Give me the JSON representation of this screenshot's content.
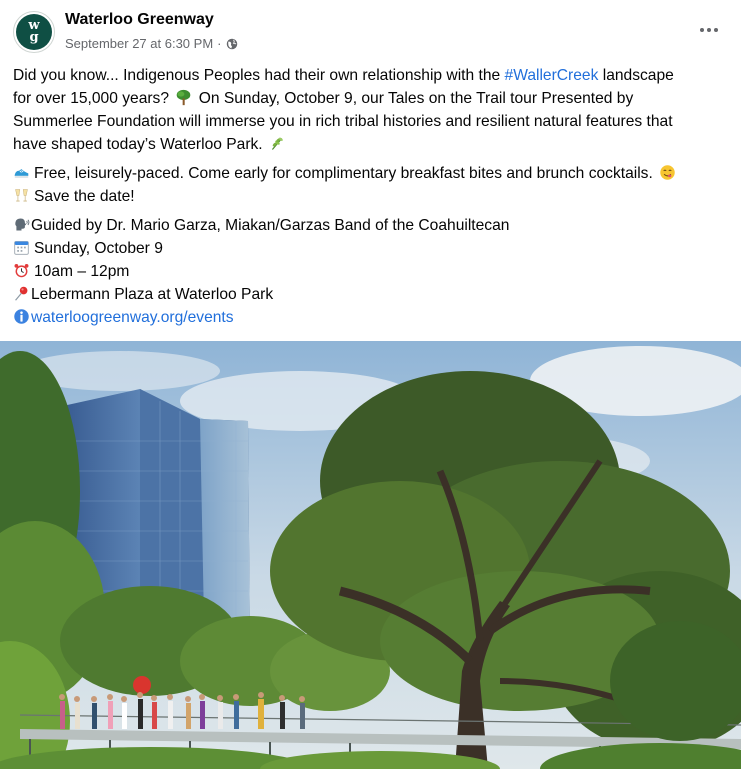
{
  "post": {
    "page_name": "Waterloo Greenway",
    "avatar_text": "wg",
    "timestamp": "September 27 at 6:30 PM",
    "separator": "·",
    "more_icon": "three-dots-icon",
    "privacy_icon": "globe-icon"
  },
  "body": {
    "p1_before_hashtag": "Did you know... Indigenous Peoples had their own relationship with the ",
    "hashtag": "#WallerCreek",
    "p1_after_hashtag": " landscape",
    "p1_line2": "for over 15,000 years?",
    "p1_line2_rest": " On Sunday, October 9, our Tales on the Trail tour Presented by",
    "p1_line3": "Summerlee Foundation will immerse you in rich tribal histories and resilient natural features that",
    "p1_line4": "have shaped today’s Waterloo Park.",
    "p2_line1": "Free, leisurely-paced. Come early for complimentary breakfast bites and brunch cocktails.",
    "p2_line2": "Save the date!",
    "guide": "Guided by Dr. Mario Garza, Miakan/Garzas Band of the Coahuiltecan",
    "date": "Sunday, October 9",
    "time": "10am – 12pm",
    "location": "Lebermann Plaza at Waterloo Park",
    "url": "waterloogreenway.org/events"
  },
  "icons": {
    "tree": "tree-emoji-icon",
    "herb": "herb-emoji-icon",
    "shoe": "running-shoe-emoji-icon",
    "yum": "face-savoring-food-emoji-icon",
    "cheers": "clinking-glasses-emoji-icon",
    "speaker": "speaking-head-emoji-icon",
    "calendar": "calendar-emoji-icon",
    "clock": "alarm-clock-emoji-icon",
    "pin": "round-pushpin-emoji-icon",
    "info": "information-emoji-icon"
  },
  "colors": {
    "link": "#216fdb",
    "meta": "#65676b",
    "avatar": "#0f4f44"
  }
}
